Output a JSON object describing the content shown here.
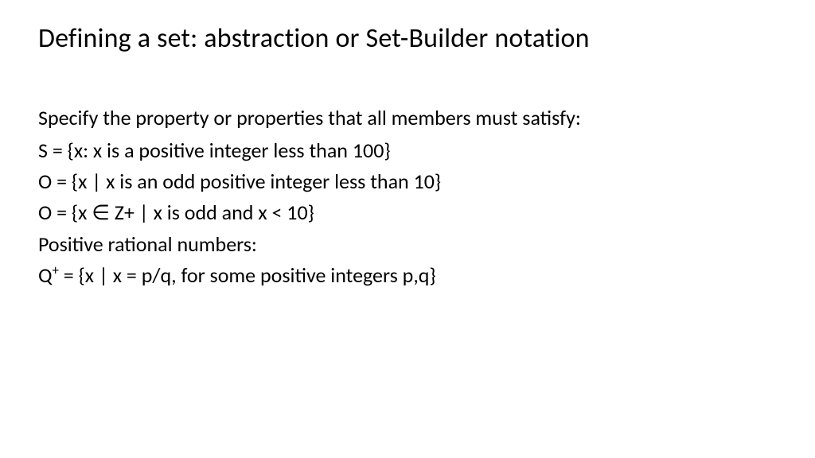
{
  "title": "Defining a set: abstraction or Set-Builder notation",
  "intro": "Specify the property or properties that all members must satisfy:",
  "lines": {
    "s_def": "S = {x: x is a positive integer less than 100}",
    "o_def1": "O = {x | x is an odd positive integer less than 10}",
    "o_def2_pre": "O = {x ",
    "o_def2_sym": "∈",
    "o_def2_post": " Z+ | x is odd and x < 10}",
    "pos_rational_label": "Positive rational numbers:",
    "q_pre": "Q",
    "q_sup": "+",
    "q_post": " = {x | x = p/q, for some positive integers p,q}"
  }
}
